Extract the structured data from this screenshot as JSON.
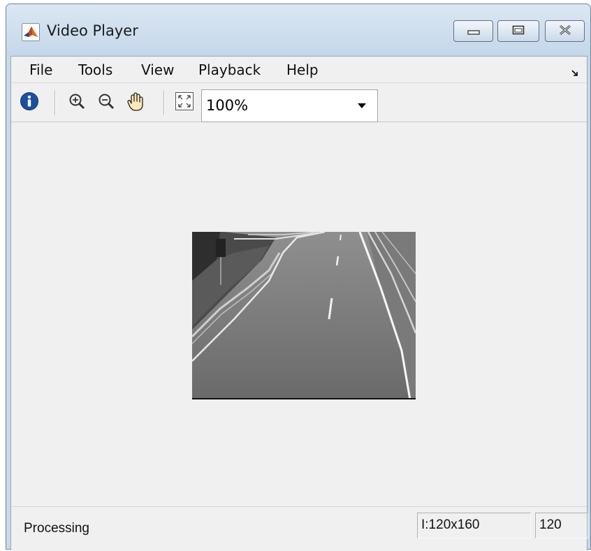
{
  "window": {
    "title": "Video Player",
    "accent": "#c8d9ea"
  },
  "menu": {
    "items": [
      "File",
      "Tools",
      "View",
      "Playback",
      "Help"
    ]
  },
  "toolbar": {
    "zoom_value": "100%",
    "icons": [
      "info-icon",
      "zoom-in-icon",
      "zoom-out-icon",
      "pan-hand-icon",
      "fit-to-window-icon"
    ]
  },
  "status": {
    "text": "Processing",
    "dimensions": "I:120x160",
    "frame": "120"
  }
}
